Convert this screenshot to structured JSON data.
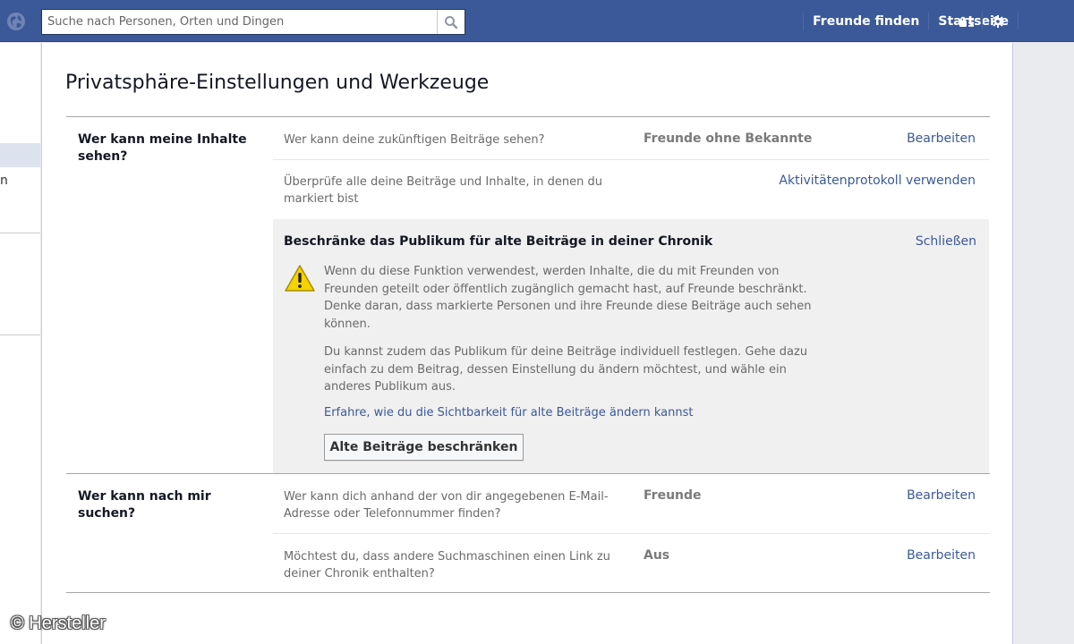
{
  "header": {
    "search_placeholder": "Suche nach Personen, Orten und Dingen",
    "nav": {
      "find_friends": "Freunde finden",
      "home": "Startseite"
    }
  },
  "sidebar": {
    "partial_item_text": "n"
  },
  "page": {
    "title": "Privatsphäre-Einstellungen und Werkzeuge"
  },
  "sections": [
    {
      "label": "Wer kann meine Inhalte sehen?",
      "rows": [
        {
          "question": "Wer kann deine zukünftigen Beiträge sehen?",
          "value": "Freunde ohne Bekannte",
          "action": "Bearbeiten"
        },
        {
          "question": "Überprüfe alle deine Beiträge und Inhalte, in denen du markiert bist",
          "action": "Aktivitätenprotokoll verwenden"
        }
      ],
      "expanded": {
        "title": "Beschränke das Publikum für alte Beiträge in deiner Chronik",
        "close": "Schließen",
        "paragraph1": "Wenn du diese Funktion verwendest, werden Inhalte, die du mit Freunden von Freunden geteilt oder öffentlich zugänglich gemacht hast, auf Freunde beschränkt. Denke daran, dass markierte Personen und ihre Freunde diese Beiträge auch sehen können.",
        "paragraph2": "Du kannst zudem das Publikum für deine Beiträge individuell festlegen. Gehe dazu einfach zu dem Beitrag, dessen Einstellung du ändern möchtest, und wähle ein anderes Publikum aus.",
        "link": "Erfahre, wie du die Sichtbarkeit für alte Beiträge ändern kannst",
        "button": "Alte Beiträge beschränken"
      }
    },
    {
      "label": "Wer kann nach mir suchen?",
      "rows": [
        {
          "question": "Wer kann dich anhand der von dir angegebenen E-Mail-Adresse oder Telefonnummer finden?",
          "value": "Freunde",
          "action": "Bearbeiten"
        },
        {
          "question": "Möchtest du, dass andere Suchmaschinen einen Link zu deiner Chronik enthalten?",
          "value": "Aus",
          "action": "Bearbeiten"
        }
      ]
    }
  ],
  "watermark": "© Hersteller",
  "colors": {
    "brand_blue": "#3b5998",
    "link": "#3b5998",
    "panel_bg": "#f0f0f0",
    "warning_yellow": "#f5d300"
  },
  "icons": [
    "globe-icon",
    "search-icon",
    "privacy-shortcuts-icon",
    "settings-gear-icon",
    "warning-icon"
  ]
}
